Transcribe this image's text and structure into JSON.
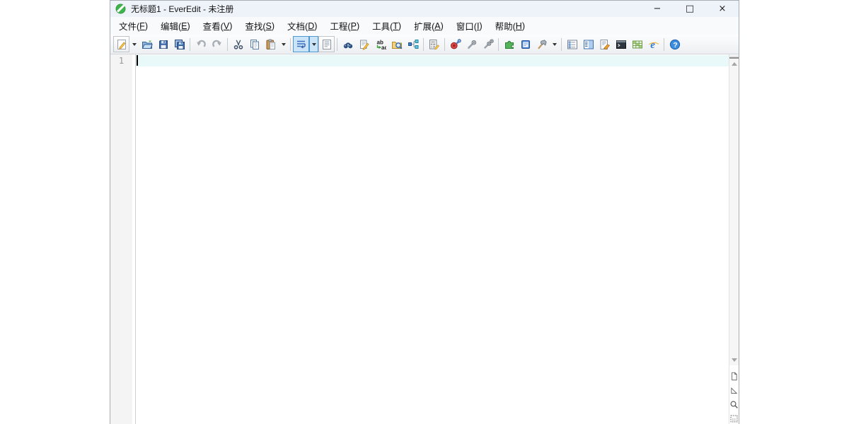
{
  "window": {
    "title": "无标题1 - EverEdit - 未注册",
    "app_name": "EverEdit",
    "controls": {
      "minimize": "−",
      "maximize": "□",
      "close": "×"
    }
  },
  "menubar": {
    "items": [
      {
        "key": "file",
        "label": "文件",
        "mnemonic": "F"
      },
      {
        "key": "edit",
        "label": "编辑",
        "mnemonic": "E"
      },
      {
        "key": "view",
        "label": "查看",
        "mnemonic": "V"
      },
      {
        "key": "search",
        "label": "查找",
        "mnemonic": "S"
      },
      {
        "key": "document",
        "label": "文档",
        "mnemonic": "D"
      },
      {
        "key": "project",
        "label": "工程",
        "mnemonic": "P"
      },
      {
        "key": "tools",
        "label": "工具",
        "mnemonic": "T"
      },
      {
        "key": "extensions",
        "label": "扩展",
        "mnemonic": "A"
      },
      {
        "key": "window",
        "label": "窗口",
        "mnemonic": "I"
      },
      {
        "key": "help",
        "label": "帮助",
        "mnemonic": "H"
      }
    ]
  },
  "toolbar": {
    "items": [
      {
        "icon": "new-file",
        "split": true,
        "framed": true
      },
      {
        "icon": "open-file"
      },
      {
        "icon": "save"
      },
      {
        "icon": "save-all"
      },
      {
        "sep": true
      },
      {
        "icon": "undo"
      },
      {
        "icon": "redo"
      },
      {
        "sep": true
      },
      {
        "icon": "cut"
      },
      {
        "icon": "copy"
      },
      {
        "icon": "paste",
        "split": true
      },
      {
        "sep": true
      },
      {
        "icon": "word-wrap",
        "split": true,
        "pressed": true
      },
      {
        "icon": "show-formatting",
        "framed": true
      },
      {
        "sep": true
      },
      {
        "icon": "find"
      },
      {
        "icon": "replace"
      },
      {
        "icon": "replace-in-files"
      },
      {
        "icon": "find-in-files"
      },
      {
        "icon": "file-compare"
      },
      {
        "sep": true
      },
      {
        "icon": "hex-edit"
      },
      {
        "sep": true
      },
      {
        "icon": "record-macro"
      },
      {
        "icon": "play-macro"
      },
      {
        "icon": "run-macro-multiple"
      },
      {
        "sep": true
      },
      {
        "icon": "plugin-manager"
      },
      {
        "icon": "script-list"
      },
      {
        "icon": "external-tools",
        "split": true
      },
      {
        "sep": true
      },
      {
        "icon": "document-map"
      },
      {
        "icon": "side-pane"
      },
      {
        "icon": "snippet"
      },
      {
        "icon": "command-window"
      },
      {
        "icon": "clip-table"
      },
      {
        "icon": "browser-preview"
      },
      {
        "sep": true
      },
      {
        "icon": "help"
      }
    ]
  },
  "editor": {
    "line_number": "1",
    "content": ""
  },
  "scrollbar": {
    "tools": [
      "page",
      "corner-triangle",
      "magnifier",
      "selection-grid"
    ]
  },
  "colors": {
    "titlebar_bg": "#eef3fa",
    "pressed_bg": "#cbe4f8",
    "pressed_border": "#4f97d1",
    "current_line": "#e9f8f9",
    "logo_green": "#3db54a"
  }
}
